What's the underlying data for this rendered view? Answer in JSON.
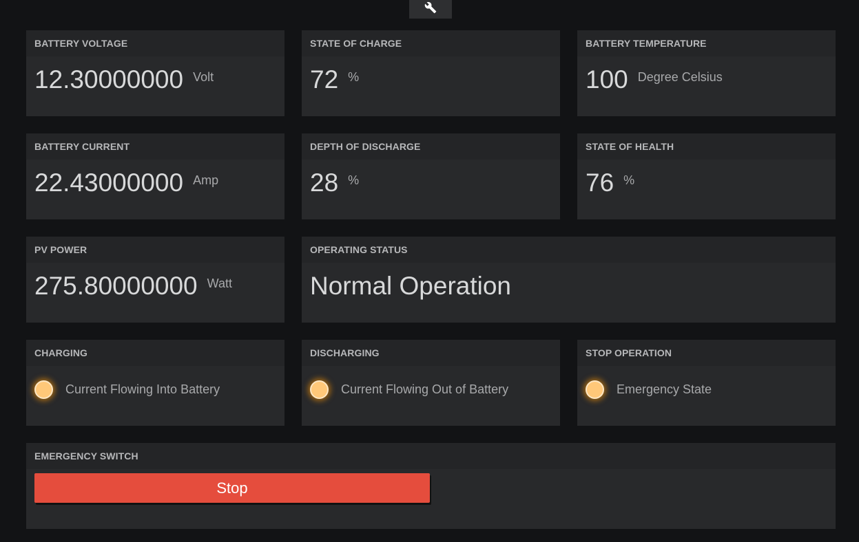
{
  "toolbar": {
    "settings_icon": "wrench-icon"
  },
  "panels": {
    "battery_voltage": {
      "title": "BATTERY VOLTAGE",
      "value": "12.30000000",
      "unit": "Volt"
    },
    "state_of_charge": {
      "title": "STATE OF CHARGE",
      "value": "72",
      "unit": "%"
    },
    "battery_temperature": {
      "title": "BATTERY TEMPERATURE",
      "value": "100",
      "unit": "Degree Celsius"
    },
    "battery_current": {
      "title": "BATTERY CURRENT",
      "value": "22.43000000",
      "unit": "Amp"
    },
    "depth_of_discharge": {
      "title": "DEPTH OF DISCHARGE",
      "value": "28",
      "unit": "%"
    },
    "state_of_health": {
      "title": "STATE OF HEALTH",
      "value": "76",
      "unit": "%"
    },
    "pv_power": {
      "title": "PV POWER",
      "value": "275.80000000",
      "unit": "Watt"
    },
    "operating_status": {
      "title": "OPERATING STATUS",
      "value": "Normal Operation"
    },
    "charging": {
      "title": "CHARGING",
      "label": "Current Flowing Into Battery"
    },
    "discharging": {
      "title": "DISCHARGING",
      "label": "Current Flowing Out of Battery"
    },
    "stop_operation": {
      "title": "STOP OPERATION",
      "label": "Emergency State"
    },
    "emergency_switch": {
      "title": "EMERGENCY SWITCH",
      "button_label": "Stop"
    }
  },
  "colors": {
    "background": "#121315",
    "panel": "#28292b",
    "indicator_led": "#ffc879",
    "stop_button": "#e54d3d"
  }
}
